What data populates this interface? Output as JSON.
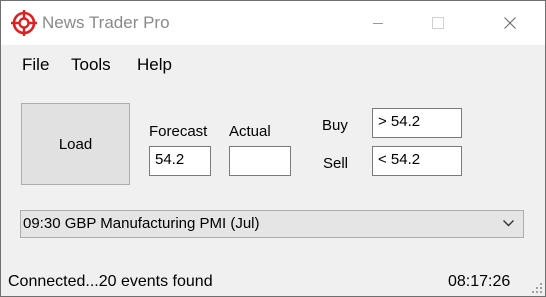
{
  "window": {
    "title": "News Trader Pro",
    "accent": "#e02020",
    "icons": {
      "app": "crosshair-target-icon",
      "minimize": "minimize-icon",
      "maximize": "maximize-icon",
      "close": "close-icon"
    }
  },
  "menu": {
    "file": "File",
    "tools": "Tools",
    "help": "Help"
  },
  "controls": {
    "load_label": "Load",
    "forecast_label": "Forecast",
    "actual_label": "Actual",
    "buy_label": "Buy",
    "sell_label": "Sell",
    "forecast_value": "54.2",
    "actual_value": "",
    "buy_value": "> 54.2",
    "sell_value": "< 54.2"
  },
  "event_select": {
    "selected": "09:30 GBP Manufacturing PMI (Jul)",
    "icon": "chevron-down-icon"
  },
  "status": {
    "text": "Connected...20 events found",
    "time": "08:17:26"
  }
}
